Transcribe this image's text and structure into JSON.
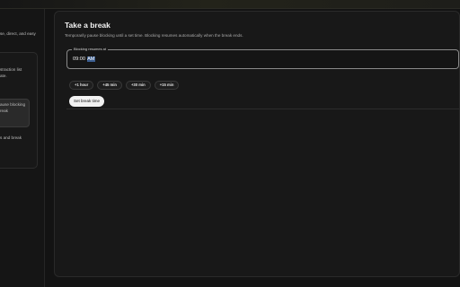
{
  "sidebar": {
    "snippets": [
      "se, direct, and easy",
      "straction list",
      "ate.",
      "ause blocking",
      "reak",
      "s and break"
    ]
  },
  "panel": {
    "title": "Take a break",
    "subtitle": "Temporarily pause blocking until a set time. Blocking resumes automatically when the break ends.",
    "field_label": "Blocking resumes at",
    "time_hours": "09:00",
    "time_ampm": "AM",
    "presets": [
      "+1 hour",
      "+45 min",
      "+30 min",
      "+15 min"
    ],
    "set_button": "Set break time"
  },
  "colors": {
    "background": "#131313",
    "panel": "#181818",
    "button": "#f1f1f1",
    "selection": "#3b5d8f"
  }
}
